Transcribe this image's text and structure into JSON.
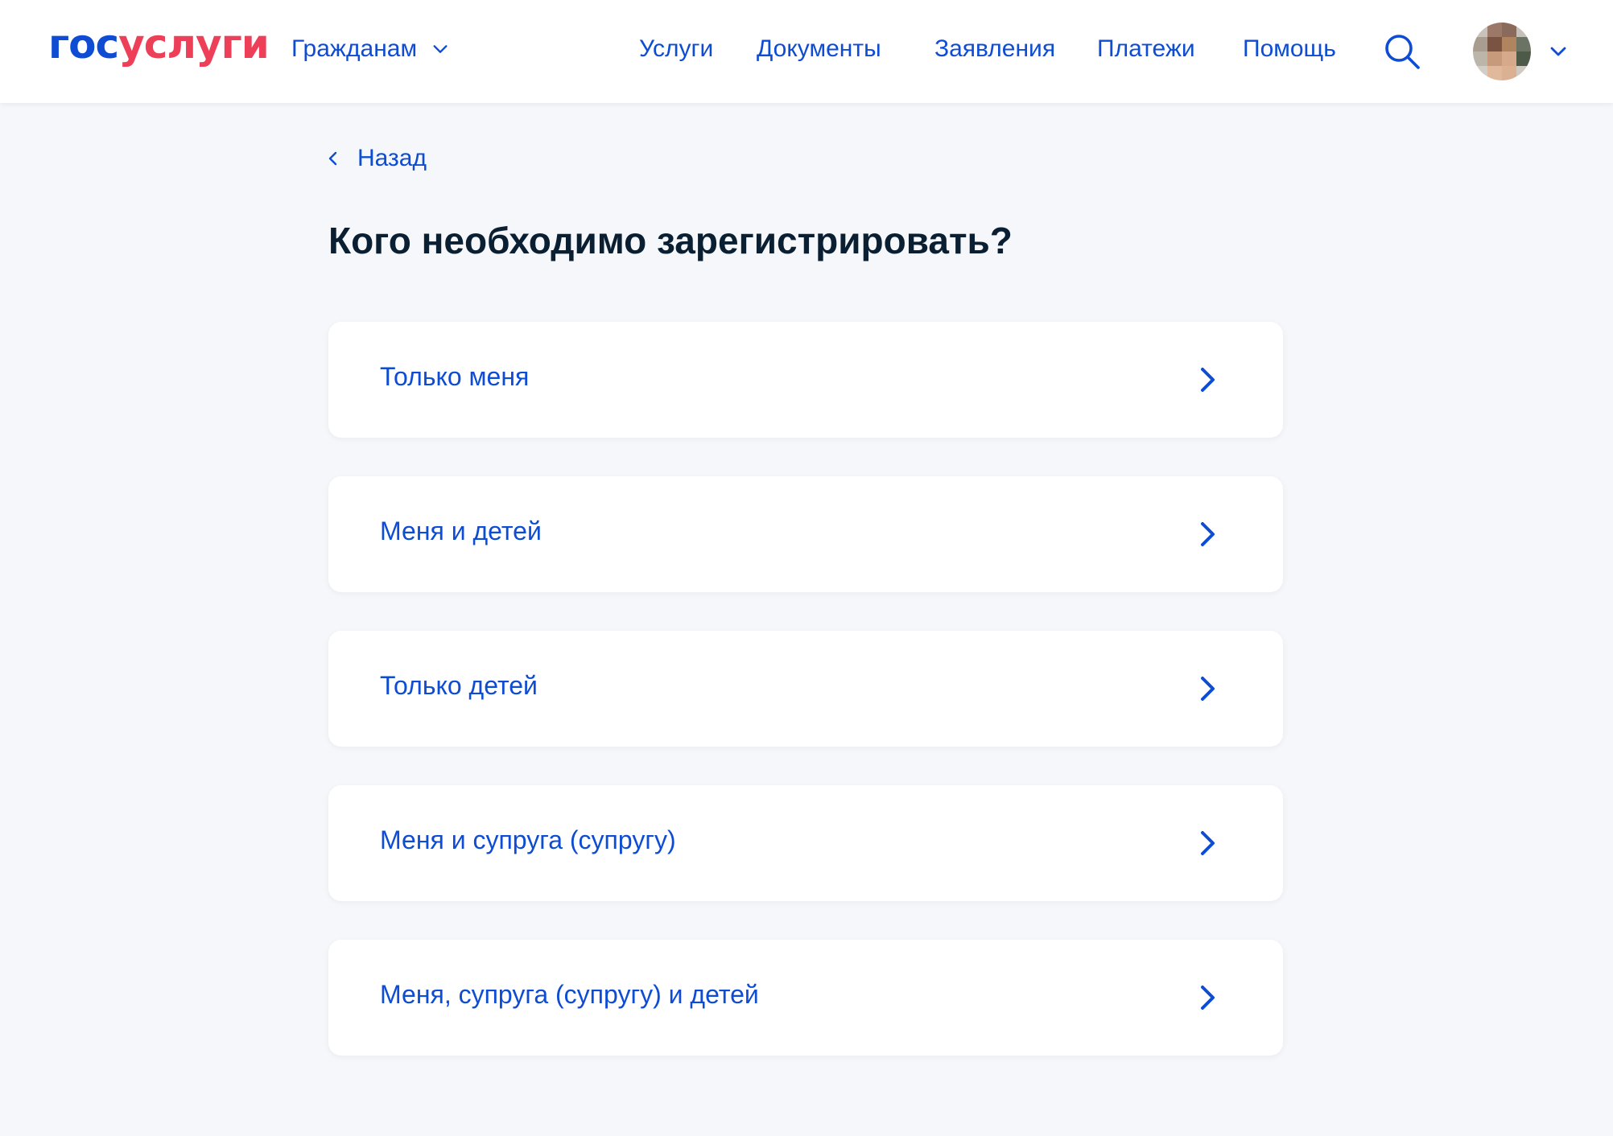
{
  "colors": {
    "brand_blue": "#0d4cd3",
    "brand_red": "#ee3f58",
    "text_dark": "#0b1f33",
    "page_bg": "#f5f7fa",
    "card_bg": "#ffffff"
  },
  "header": {
    "logo_part1": "гос",
    "logo_part2": "услуги",
    "audience_label": "Гражданам",
    "nav": [
      "Услуги",
      "Документы",
      "Заявления",
      "Платежи",
      "Помощь"
    ],
    "search_icon": "search-icon",
    "avatar_icon": "avatar-pixelated"
  },
  "page": {
    "back_label": "Назад",
    "title": "Кого необходимо зарегистрировать?",
    "options": [
      "Только меня",
      "Меня и детей",
      "Только детей",
      "Меня и супруга (супругу)",
      "Меня, супруга (супругу) и детей"
    ]
  }
}
